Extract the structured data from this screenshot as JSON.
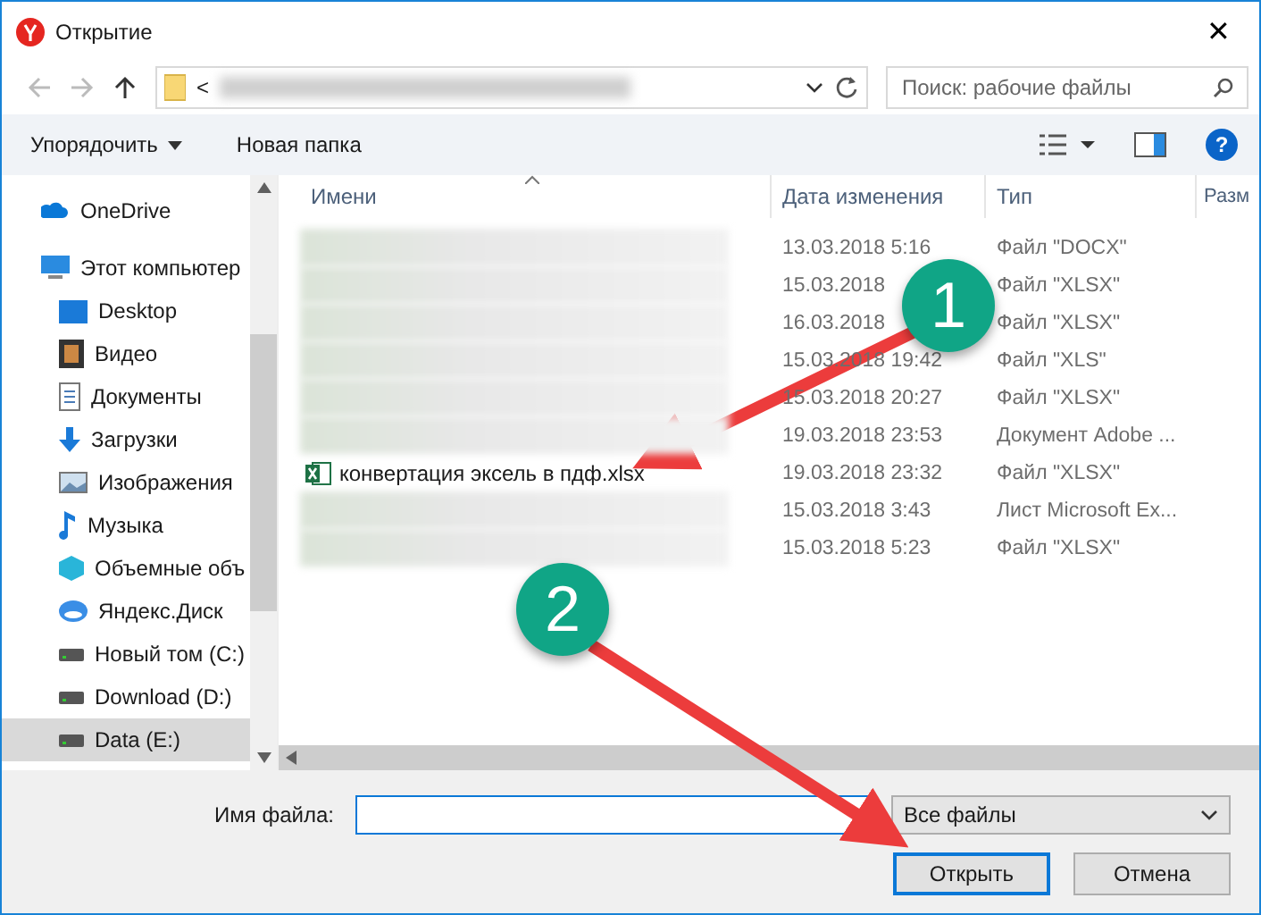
{
  "window": {
    "title": "Открытие",
    "close": "✕"
  },
  "nav": {
    "path_prefix": "<",
    "search": {
      "placeholder": "Поиск: рабочие файлы"
    }
  },
  "toolbar": {
    "organize": "Упорядочить",
    "new_folder": "Новая папка",
    "help": "?"
  },
  "sidebar": {
    "items": [
      {
        "label": "OneDrive",
        "selected": false
      },
      {
        "label": "Этот компьютер",
        "selected": false,
        "children": [
          {
            "label": "Desktop",
            "selected": false
          },
          {
            "label": "Видео",
            "selected": false
          },
          {
            "label": "Документы",
            "selected": false
          },
          {
            "label": "Загрузки",
            "selected": false
          },
          {
            "label": "Изображения",
            "selected": false
          },
          {
            "label": "Музыка",
            "selected": false
          },
          {
            "label": "Объемные объ",
            "selected": false
          },
          {
            "label": "Яндекс.Диск",
            "selected": false
          },
          {
            "label": "Новый том (C:)",
            "selected": false
          },
          {
            "label": "Download (D:)",
            "selected": false
          },
          {
            "label": "Data (E:)",
            "selected": true
          }
        ]
      }
    ]
  },
  "table": {
    "columns": [
      "Имени",
      "Дата изменения",
      "Тип",
      "Разм"
    ],
    "rows": [
      {
        "kind": "blurred",
        "date": "13.03.2018 5:16",
        "type": "Файл \"DOCX\""
      },
      {
        "kind": "blurred",
        "date": "15.03.2018",
        "type": "Файл \"XLSX\""
      },
      {
        "kind": "blurred",
        "date": "16.03.2018",
        "type": "Файл \"XLSX\""
      },
      {
        "kind": "blurred",
        "date": "15.03.2018 19:42",
        "type": "Файл \"XLS\""
      },
      {
        "kind": "blurred",
        "date": "15.03.2018 20:27",
        "type": "Файл \"XLSX\""
      },
      {
        "kind": "blurred",
        "date": "19.03.2018 23:53",
        "type": "Документ Adobe ..."
      },
      {
        "kind": "file",
        "name": "конвертация эксель в пдф.xlsx",
        "date": "19.03.2018 23:32",
        "type": "Файл \"XLSX\""
      },
      {
        "kind": "blurred",
        "date": "15.03.2018 3:43",
        "type": "Лист Microsoft Ex..."
      },
      {
        "kind": "blurred",
        "date": "15.03.2018 5:23",
        "type": "Файл \"XLSX\""
      }
    ]
  },
  "footer": {
    "filename_label": "Имя файла:",
    "filter": "Все файлы",
    "open": "Открыть",
    "cancel": "Отмена"
  },
  "annotations": [
    {
      "label": "1"
    },
    {
      "label": "2"
    }
  ]
}
